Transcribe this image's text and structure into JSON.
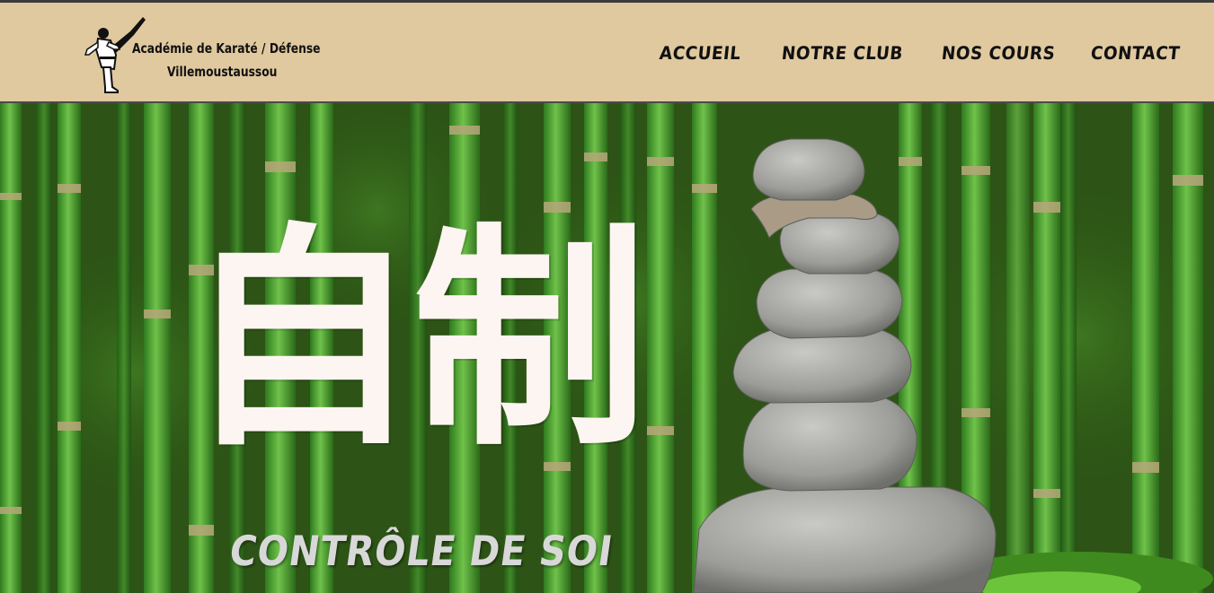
{
  "header": {
    "logo": {
      "line1": "Académie de Karaté / Défense",
      "line2": "Villemoustaussou",
      "icon": "karate-kick-figure"
    },
    "nav": [
      {
        "label": "ACCUEIL"
      },
      {
        "label": "NOTRE CLUB"
      },
      {
        "label": "NOS COURS"
      },
      {
        "label": "CONTACT"
      }
    ]
  },
  "hero": {
    "kanji": "自制",
    "subtitle": "CONTRÔLE DE SOI"
  },
  "colors": {
    "header_bg": "#e0c99f",
    "kanji": "#fdf5f2",
    "subtitle": "#d8d8d8"
  }
}
